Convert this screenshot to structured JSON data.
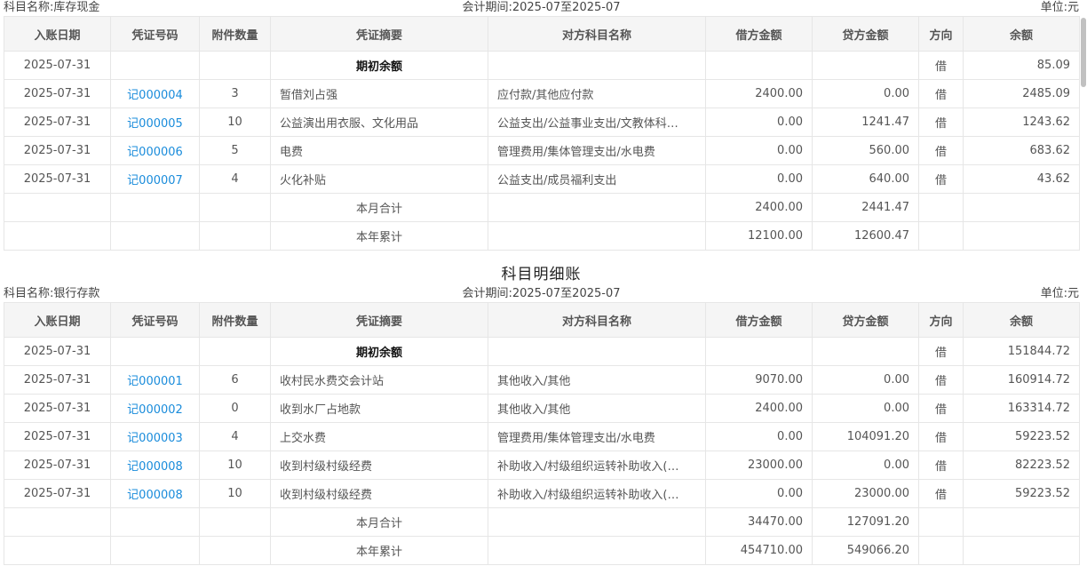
{
  "headers": [
    "入账日期",
    "凭证号码",
    "附件数量",
    "凭证摘要",
    "对方科目名称",
    "借方金额",
    "贷方金额",
    "方向",
    "余额"
  ],
  "sections": [
    {
      "title": "",
      "subject": "科目名称:库存现金",
      "period": "会计期间:2025-07至2025-07",
      "unit": "单位:元",
      "rows": [
        {
          "date": "2025-07-31",
          "voucher": "",
          "attachments": "",
          "summary": "期初余额",
          "counter": "",
          "debit": "",
          "credit": "",
          "direction": "借",
          "balance": "85.09",
          "bold": true
        },
        {
          "date": "2025-07-31",
          "voucher": "记000004",
          "attachments": "3",
          "summary": "暂借刘占强",
          "counter": "应付款/其他应付款",
          "debit": "2400.00",
          "credit": "0.00",
          "direction": "借",
          "balance": "2485.09"
        },
        {
          "date": "2025-07-31",
          "voucher": "记000005",
          "attachments": "10",
          "summary": "公益演出用衣服、文化用品",
          "counter": "公益支出/公益事业支出/文教体科…",
          "debit": "0.00",
          "credit": "1241.47",
          "direction": "借",
          "balance": "1243.62"
        },
        {
          "date": "2025-07-31",
          "voucher": "记000006",
          "attachments": "5",
          "summary": "电费",
          "counter": "管理费用/集体管理支出/水电费",
          "debit": "0.00",
          "credit": "560.00",
          "direction": "借",
          "balance": "683.62"
        },
        {
          "date": "2025-07-31",
          "voucher": "记000007",
          "attachments": "4",
          "summary": "火化补贴",
          "counter": "公益支出/成员福利支出",
          "debit": "0.00",
          "credit": "640.00",
          "direction": "借",
          "balance": "43.62"
        },
        {
          "date": "",
          "voucher": "",
          "attachments": "",
          "summary": "本月合计",
          "counter": "",
          "debit": "2400.00",
          "credit": "2441.47",
          "direction": "",
          "balance": "",
          "total": true
        },
        {
          "date": "",
          "voucher": "",
          "attachments": "",
          "summary": "本年累计",
          "counter": "",
          "debit": "12100.00",
          "credit": "12600.47",
          "direction": "",
          "balance": "",
          "total": true
        }
      ]
    },
    {
      "title": "科目明细账",
      "subject": "科目名称:银行存款",
      "period": "会计期间:2025-07至2025-07",
      "unit": "单位:元",
      "rows": [
        {
          "date": "2025-07-31",
          "voucher": "",
          "attachments": "",
          "summary": "期初余额",
          "counter": "",
          "debit": "",
          "credit": "",
          "direction": "借",
          "balance": "151844.72",
          "bold": true
        },
        {
          "date": "2025-07-31",
          "voucher": "记000001",
          "attachments": "6",
          "summary": "收村民水费交会计站",
          "counter": "其他收入/其他",
          "debit": "9070.00",
          "credit": "0.00",
          "direction": "借",
          "balance": "160914.72"
        },
        {
          "date": "2025-07-31",
          "voucher": "记000002",
          "attachments": "0",
          "summary": "收到水厂占地款",
          "counter": "其他收入/其他",
          "debit": "2400.00",
          "credit": "0.00",
          "direction": "借",
          "balance": "163314.72"
        },
        {
          "date": "2025-07-31",
          "voucher": "记000003",
          "attachments": "4",
          "summary": "上交水费",
          "counter": "管理费用/集体管理支出/水电费",
          "debit": "0.00",
          "credit": "104091.20",
          "direction": "借",
          "balance": "59223.52"
        },
        {
          "date": "2025-07-31",
          "voucher": "记000008",
          "attachments": "10",
          "summary": "收到村级村级经费",
          "counter": "补助收入/村级组织运转补助收入(…",
          "debit": "23000.00",
          "credit": "0.00",
          "direction": "借",
          "balance": "82223.52"
        },
        {
          "date": "2025-07-31",
          "voucher": "记000008",
          "attachments": "10",
          "summary": "收到村级村级经费",
          "counter": "补助收入/村级组织运转补助收入(…",
          "debit": "0.00",
          "credit": "23000.00",
          "direction": "借",
          "balance": "59223.52"
        },
        {
          "date": "",
          "voucher": "",
          "attachments": "",
          "summary": "本月合计",
          "counter": "",
          "debit": "34470.00",
          "credit": "127091.20",
          "direction": "",
          "balance": "",
          "total": true
        },
        {
          "date": "",
          "voucher": "",
          "attachments": "",
          "summary": "本年累计",
          "counter": "",
          "debit": "454710.00",
          "credit": "549066.20",
          "direction": "",
          "balance": "",
          "total": true
        }
      ]
    }
  ]
}
